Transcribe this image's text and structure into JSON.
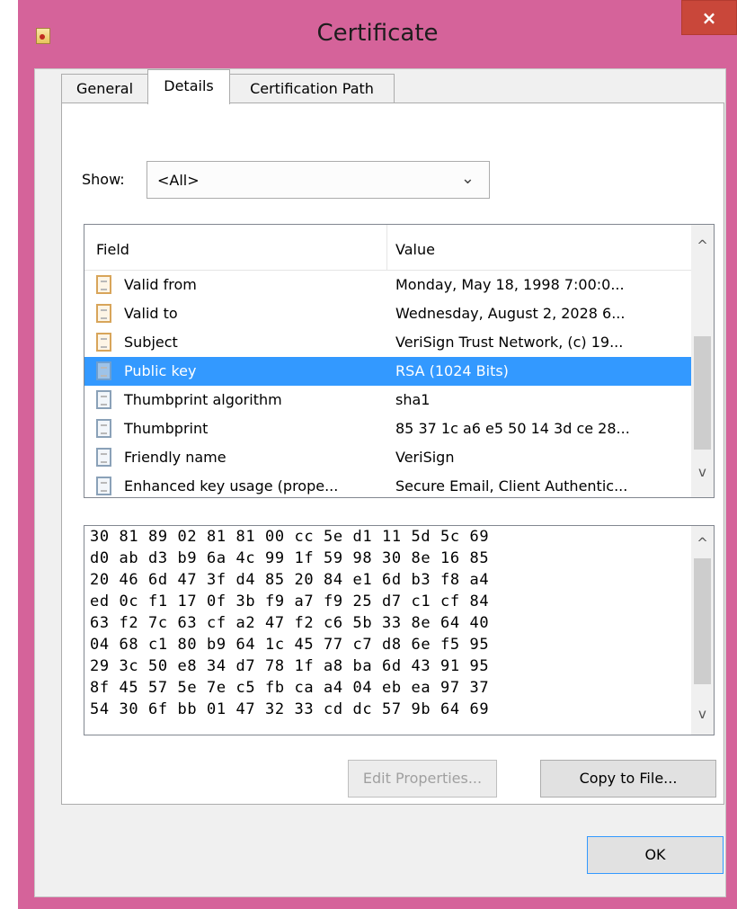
{
  "window": {
    "title": "Certificate",
    "close_glyph": "×",
    "app_icon": "certificate-icon"
  },
  "tabs": [
    {
      "label": "General",
      "active": false
    },
    {
      "label": "Details",
      "active": true
    },
    {
      "label": "Certification Path",
      "active": false
    }
  ],
  "show": {
    "label": "Show:",
    "selected": "<All>"
  },
  "list": {
    "headers": {
      "field": "Field",
      "value": "Value"
    },
    "rows": [
      {
        "field": "Valid from",
        "value": "Monday, May 18, 1998 7:00:0...",
        "icon": "certificate-field-icon"
      },
      {
        "field": "Valid to",
        "value": "Wednesday, August 2, 2028 6...",
        "icon": "certificate-field-icon"
      },
      {
        "field": "Subject",
        "value": "VeriSign Trust Network, (c) 19...",
        "icon": "certificate-field-icon"
      },
      {
        "field": "Public key",
        "value": "RSA (1024 Bits)",
        "icon": "certificate-field-icon",
        "selected": true
      },
      {
        "field": "Thumbprint algorithm",
        "value": "sha1",
        "icon": "property-icon"
      },
      {
        "field": "Thumbprint",
        "value": "85 37 1c a6 e5 50 14 3d ce 28...",
        "icon": "property-icon"
      },
      {
        "field": "Friendly name",
        "value": "VeriSign",
        "icon": "property-icon"
      },
      {
        "field": "Enhanced key usage (prope...",
        "value": "Secure Email, Client Authentic...",
        "icon": "property-icon"
      }
    ]
  },
  "hex_lines": [
    "30 81 89 02 81 81 00 cc 5e d1 11 5d 5c 69",
    "d0 ab d3 b9 6a 4c 99 1f 59 98 30 8e 16 85",
    "20 46 6d 47 3f d4 85 20 84 e1 6d b3 f8 a4",
    "ed 0c f1 17 0f 3b f9 a7 f9 25 d7 c1 cf 84",
    "63 f2 7c 63 cf a2 47 f2 c6 5b 33 8e 64 40",
    "04 68 c1 80 b9 64 1c 45 77 c7 d8 6e f5 95",
    "29 3c 50 e8 34 d7 78 1f a8 ba 6d 43 91 95",
    "8f 45 57 5e 7e c5 fb ca a4 04 eb ea 97 37",
    "54 30 6f bb 01 47 32 33 cd dc 57 9b 64 69"
  ],
  "buttons": {
    "edit_properties": "Edit Properties...",
    "copy_to_file": "Copy to File...",
    "ok": "OK"
  },
  "scroll_glyphs": {
    "up": "^",
    "down": "v"
  },
  "colors": {
    "frame": "#d5639a",
    "close": "#c9473a",
    "selection": "#3399ff"
  }
}
